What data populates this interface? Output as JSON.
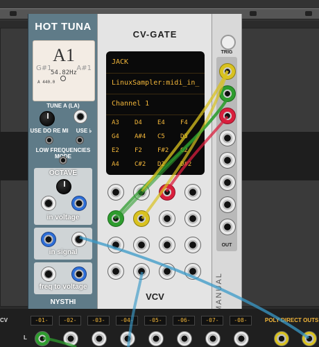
{
  "hottuna": {
    "title": "HOT TUNA",
    "tuner": {
      "note": "A1",
      "left_note": "G#1",
      "right_note": "A#1",
      "freq": "54.82Hz",
      "ref": "A 440.0"
    },
    "tune_label": "TUNE A (LA)",
    "use_do_re_mi": "USE DO RE MI",
    "use_flat": "USE ♭",
    "low_freq_mode": "LOW FREQUENCIES MODE",
    "octave_label": "OCTAVE",
    "in_voltage": "in voltage",
    "in_signal": "in signal",
    "freq_to_voltage": "freq to voltage",
    "brand": "NYSTHI"
  },
  "cvgate": {
    "title": "CV-GATE",
    "screen": {
      "line1": "JACK",
      "line2": "LinuxSampler:midi_in_",
      "line3": "Channel 1"
    },
    "notes": [
      [
        "A3",
        "D4",
        "E4",
        "F4"
      ],
      [
        "G4",
        "A#4",
        "C5",
        "D5"
      ],
      [
        "E2",
        "F2",
        "F#2",
        "G2"
      ],
      [
        "A4",
        "C#2",
        "D2",
        "D#2"
      ]
    ],
    "brand": "VCV"
  },
  "manual": {
    "trig": "TRIG",
    "out": "OUT",
    "title": "MANUAL"
  },
  "bottom": {
    "left_label": "CV",
    "channels": [
      "-01-",
      "-02-",
      "-03-",
      "-04-",
      "-05-",
      "-06-",
      "-07-",
      "-08-"
    ],
    "l_label": "L",
    "poly_label": "POLY DIRECT OUTS"
  },
  "colors": {
    "amber": "#f2b63a",
    "hottuna_panel": "#5f7b88",
    "cable_green": "#2e9c2e",
    "cable_yellow": "#d9c21f",
    "cable_red": "#d91f3d",
    "cable_blue": "#3a9ac8"
  }
}
